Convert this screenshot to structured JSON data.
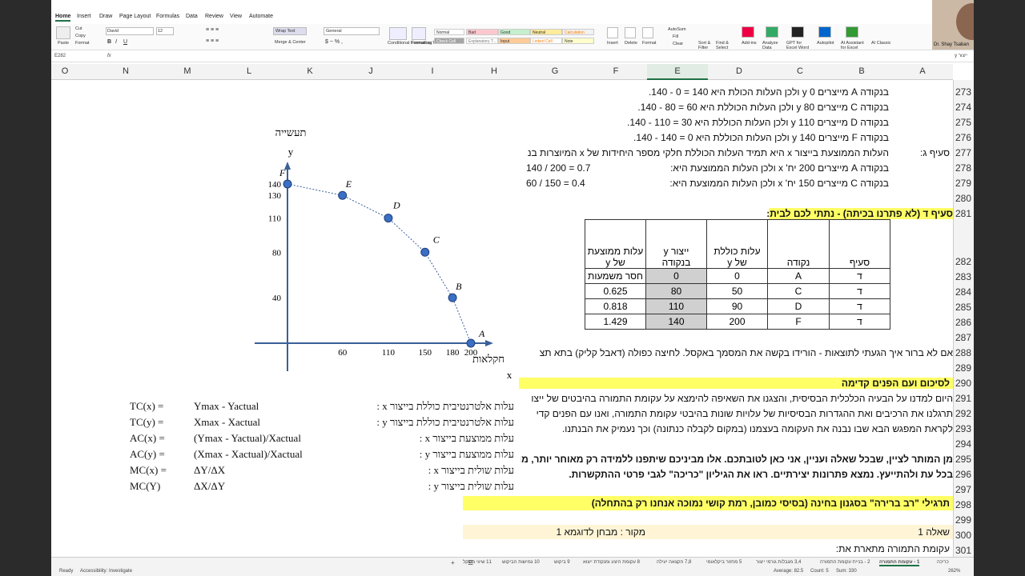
{
  "ribbon": {
    "tabs": [
      "Home",
      "Insert",
      "Draw",
      "Page Layout",
      "Formulas",
      "Data",
      "Review",
      "View",
      "Automate"
    ],
    "paste": "Paste",
    "cut": "Cut",
    "copy": "Copy",
    "format": "Format",
    "font": "David",
    "font_size": "12",
    "wrap_text": "Wrap Text",
    "merge_center": "Merge & Center",
    "number_format": "General",
    "styles": [
      "Normal",
      "Bad",
      "Good",
      "Neutral",
      "Calculation",
      "Check Cell",
      "Explanatory T...",
      "Input",
      "Linked Cell",
      "Note"
    ],
    "cond_format": "Conditional Formatting",
    "format_table": "Format as Table",
    "insert": "Insert",
    "delete": "Delete",
    "format_cells": "Format",
    "autosum": "AutoSum",
    "fill": "Fill",
    "clear": "Clear",
    "sort_filter": "Sort & Filter",
    "find_select": "Find & Select",
    "addins": "Add-ins",
    "analyze": "Analyze Data",
    "gpt": "GPT for Excel Word",
    "autopilot": "Autopilot",
    "ai_asst": "AI Assistant for Excel",
    "classic": "AI Classic",
    "user": "Dr. Shay Tsaban"
  },
  "formula_bar": {
    "name_box": "E282",
    "fx": "fx",
    "value": "ייצור y"
  },
  "columns": [
    "O",
    "N",
    "M",
    "L",
    "K",
    "J",
    "I",
    "H",
    "G",
    "F",
    "E",
    "D",
    "C",
    "B",
    "A"
  ],
  "selected_col": "E",
  "rows": [
    "273",
    "274",
    "275",
    "276",
    "277",
    "278",
    "279",
    "280",
    "281",
    "282",
    "283",
    "284",
    "285",
    "286",
    "287",
    "288",
    "289",
    "290",
    "291",
    "292",
    "293",
    "294",
    "295",
    "296",
    "297",
    "298",
    "299",
    "300",
    "301"
  ],
  "text_rows": {
    "r273": "בנקודה A מייצרים 0 y ולכן העלות הכולת היא 140 = 0 - 140.",
    "r274": "בנקודה C מייצרים 80 y ולכן העלות הכוללת היא 60 = 80 - 140.",
    "r275": "בנקודה D מייצרים 110 y ולכן העלות הכוללת היא 30 = 110 - 140.",
    "r276": "בנקודה F מייצרים 140 y ולכן העלות הכוללת היא 0 = 140 - 140.",
    "r277_b": "סעיף ג:",
    "r277": "העלות הממוצעת בייצור x היא תמיד העלות הכוללת חלקי מספר היחידות של x המיוצרות בנ",
    "r278": "בנקודה A מייצרים 200 יח' x ולכן העלות הממוצעת היא:",
    "r278_val": "140 / 200 = 0.7",
    "r279": "בנקודה C מייצרים 150 יח' x ולכן העלות הממוצעת היא:",
    "r279_val": "60 / 150 = 0.4",
    "r281": "סעיף ד (לא פתרנו בכיתה) - נתתי לכם לבית:",
    "r288": "אם לא ברור איך הגעתי לתוצאות - הורידו בקשה את המסמך באקסל. לחיצה כפולה (דאבל קליק) בתא תצ",
    "r290": "לסיכום ועם הפנים קדימה",
    "r291": "היום למדנו על הבעיה הכלכלית הבסיסית, והצגנו את השאיפה להימצא על עקומת התמורה בהיבטים של ייצו",
    "r292": "תרגלנו את הרכיבים ואת ההגדרות הבסיסיות של עלויות שונות בהיבטי עקומת התמורה, ואנו עם הפנים קדי",
    "r293": "לקראת המפגש הבא שבו נבנה את העקומה בעצמנו (במקום לקבלה כנתונה) וכך נעמיק את הבנתנו.",
    "r295": "מן המותר לציין, שבכל שאלה ועניין, אני כאן לטובתכם. אלו מביניכם שיתפנו ללמידה רק מאוחר יותר, מוזמ",
    "r296": "בכל עת ולהתייעץ. נמצא פתרונות יצירתיים. ראו את הגיליון \"כריכה\" לגבי פרטי ההתקשרות.",
    "r298": "תרגילי \"רב ברירה\" בסגנון בחינה (בסיסי כמובן, רמת קושי נמוכה אנחנו רק בהתחלה)",
    "r300_a": "שאלה 1",
    "r300_src": "מקור : מבחן לדוגמא 1",
    "r301": "עקומת התמורה מתארת את:"
  },
  "table": {
    "headers": [
      "סעיף",
      "נקודה",
      "עלות כוללת\nשל y",
      "ייצור y\nבנקודה",
      "עלות ממוצעת\nשל y"
    ],
    "rows": [
      [
        "ד",
        "A",
        "0",
        "0",
        "חסר משמעות"
      ],
      [
        "ד",
        "C",
        "50",
        "80",
        "0.625"
      ],
      [
        "ד",
        "D",
        "90",
        "110",
        "0.818"
      ],
      [
        "ד",
        "F",
        "200",
        "140",
        "1.429"
      ]
    ]
  },
  "formulas": [
    {
      "desc": "עלות אלטרנטיבית כוללת בייצור x :",
      "name": "TC(x) =",
      "expr": "Ymax - Yactual"
    },
    {
      "desc": "עלות אלטרנטיבית כוללת בייצור y :",
      "name": "TC(y) =",
      "expr": "Xmax - Xactual"
    },
    {
      "desc": "עלות ממוצעת בייצור x :",
      "name": "AC(x) =",
      "expr": "(Ymax - Yactual)/Xactual"
    },
    {
      "desc": "עלות ממוצעת בייצור y :",
      "name": "AC(y) =",
      "expr": "(Xmax - Xactual)/Xactual"
    },
    {
      "desc": "עלות שולית בייצור x :",
      "name": "MC(x) =",
      "expr": "ΔY/ΔX"
    },
    {
      "desc": "עלות שולית בייצור y :",
      "name": "MC(Y)",
      "expr": "ΔX/ΔY"
    }
  ],
  "chart_data": {
    "type": "line",
    "ylabel_top": "תעשייה",
    "ylabel": "y",
    "xlabel": "חקלאות",
    "xlabel_sub": "x",
    "points": [
      {
        "label": "F",
        "x": 0,
        "y": 140
      },
      {
        "label": "E",
        "x": 60,
        "y": 130
      },
      {
        "label": "D",
        "x": 110,
        "y": 110
      },
      {
        "label": "C",
        "x": 150,
        "y": 80
      },
      {
        "label": "B",
        "x": 180,
        "y": 40
      },
      {
        "label": "A",
        "x": 200,
        "y": 0
      }
    ],
    "x_ticks": [
      "60",
      "110",
      "150",
      "180",
      "200"
    ],
    "y_ticks": [
      "140",
      "130",
      "110",
      "80",
      "40"
    ]
  },
  "status": {
    "ready": "Ready",
    "access": "Accessibility: Investigate",
    "average": "Average: 82.5",
    "count": "Count: 5",
    "sum": "Sum: 330",
    "zoom": "262%",
    "sheets": [
      "כריכה",
      "1 - עקומת התמורה",
      "2 - בניית עקומת התמורה",
      "3,4 מגבלות גורמי ייצור",
      "5 מחזור ביקלאומי",
      "7,8 הקצאה יעילה",
      "8 עקומת היצע ומנקודת ייצוא",
      "9 ביקוש",
      "10 גמישות הביקוש",
      "11 שיווי משקל"
    ]
  }
}
